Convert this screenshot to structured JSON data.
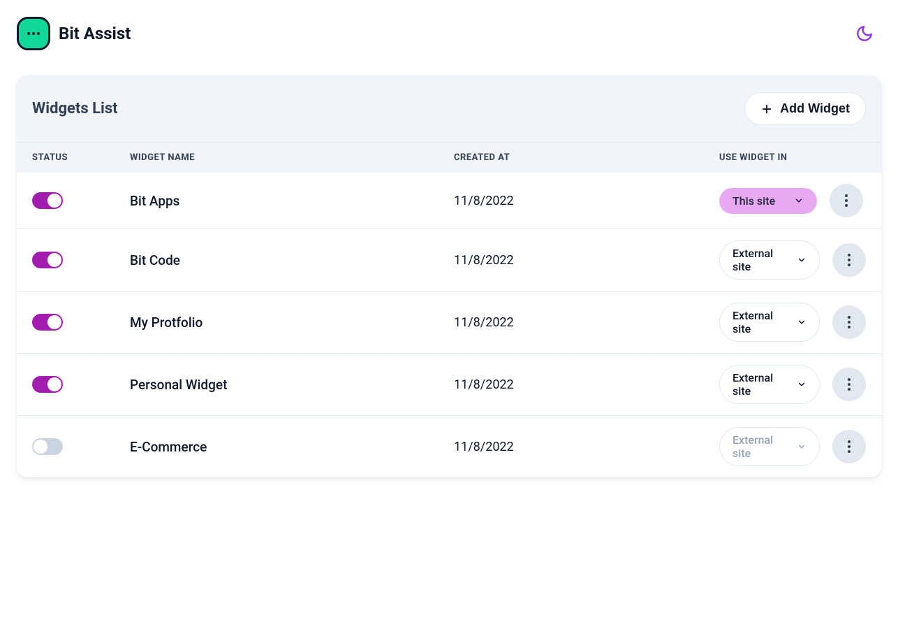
{
  "app": {
    "title": "Bit Assist"
  },
  "card": {
    "title": "Widgets List",
    "add_label": "Add Widget"
  },
  "columns": {
    "status": "Status",
    "name": "Widget Name",
    "created": "Created At",
    "use": "Use Widget In"
  },
  "use_options": {
    "this_site": "This site",
    "external_site": "External site"
  },
  "rows": [
    {
      "enabled": true,
      "name": "Bit Apps",
      "created_at": "11/8/2022",
      "use_in": "this_site",
      "pill_style": "primary"
    },
    {
      "enabled": true,
      "name": "Bit Code",
      "created_at": "11/8/2022",
      "use_in": "external_site",
      "pill_style": "outline"
    },
    {
      "enabled": true,
      "name": "My Protfolio",
      "created_at": "11/8/2022",
      "use_in": "external_site",
      "pill_style": "outline"
    },
    {
      "enabled": true,
      "name": "Personal Widget",
      "created_at": "11/8/2022",
      "use_in": "external_site",
      "pill_style": "outline"
    },
    {
      "enabled": false,
      "name": "E-Commerce",
      "created_at": "11/8/2022",
      "use_in": "external_site",
      "pill_style": "disabled"
    }
  ],
  "colors": {
    "accent_green": "#10d997",
    "accent_purple": "#a21caf",
    "accent_pink": "#e9a8f2",
    "theme_icon": "#9333ea"
  }
}
